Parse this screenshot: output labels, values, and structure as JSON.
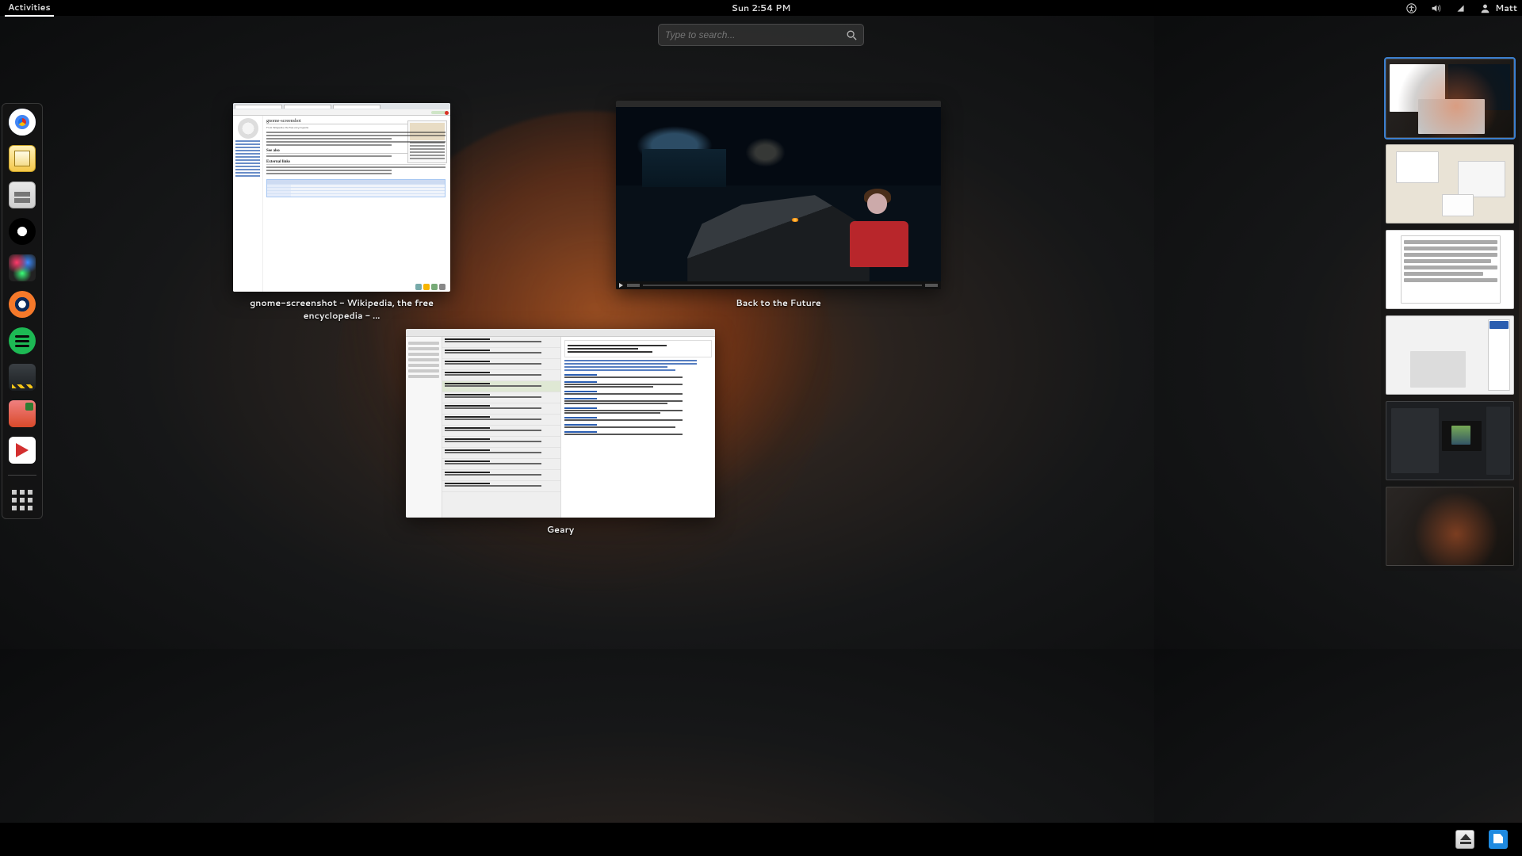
{
  "top_panel": {
    "activities": "Activities",
    "clock": "Sun  2:54 PM",
    "user_name": "Matt",
    "icons": {
      "accessibility": "accessibility-icon",
      "volume": "volume-icon",
      "network": "network-icon",
      "user": "user-icon"
    }
  },
  "search": {
    "placeholder": "Type to search..."
  },
  "dash": {
    "apps": [
      {
        "name": "google-chrome",
        "label": "Google Chrome"
      },
      {
        "name": "evolution-mail",
        "label": "Mail"
      },
      {
        "name": "nautilus-files",
        "label": "Files"
      },
      {
        "name": "scrivener",
        "label": "Scrivener"
      },
      {
        "name": "color-picker",
        "label": "Colors"
      },
      {
        "name": "blender",
        "label": "Blender"
      },
      {
        "name": "spotify",
        "label": "Spotify"
      },
      {
        "name": "steam",
        "label": "Steam"
      },
      {
        "name": "libreoffice-impress",
        "label": "Impress"
      },
      {
        "name": "media-player",
        "label": "Media Player"
      }
    ],
    "show_apps": "Show Applications"
  },
  "windows": [
    {
      "id": "browser",
      "title": "gnome-screenshot - Wikipedia, the free encyclopedia - ...",
      "app": "Google Chrome"
    },
    {
      "id": "video",
      "title": "Back to the Future",
      "app": "Videos"
    },
    {
      "id": "geary",
      "title": "Geary",
      "app": "Geary"
    }
  ],
  "wiki": {
    "article_title": "gnome-screenshot",
    "subtitle": "From Wikipedia, the free encyclopedia",
    "sections": [
      "See also",
      "External links"
    ]
  },
  "workspaces": {
    "count": 6,
    "active_index": 0,
    "items": [
      {
        "label": "Workspace 1",
        "active": true
      },
      {
        "label": "Workspace 2",
        "active": false
      },
      {
        "label": "Workspace 3",
        "active": false
      },
      {
        "label": "Workspace 4",
        "active": false
      },
      {
        "label": "Workspace 5",
        "active": false
      },
      {
        "label": "Workspace 6",
        "active": false
      }
    ]
  },
  "tray": {
    "items": [
      {
        "name": "removable-media",
        "label": "Removable Media"
      },
      {
        "name": "dropbox",
        "label": "Dropbox"
      }
    ]
  }
}
